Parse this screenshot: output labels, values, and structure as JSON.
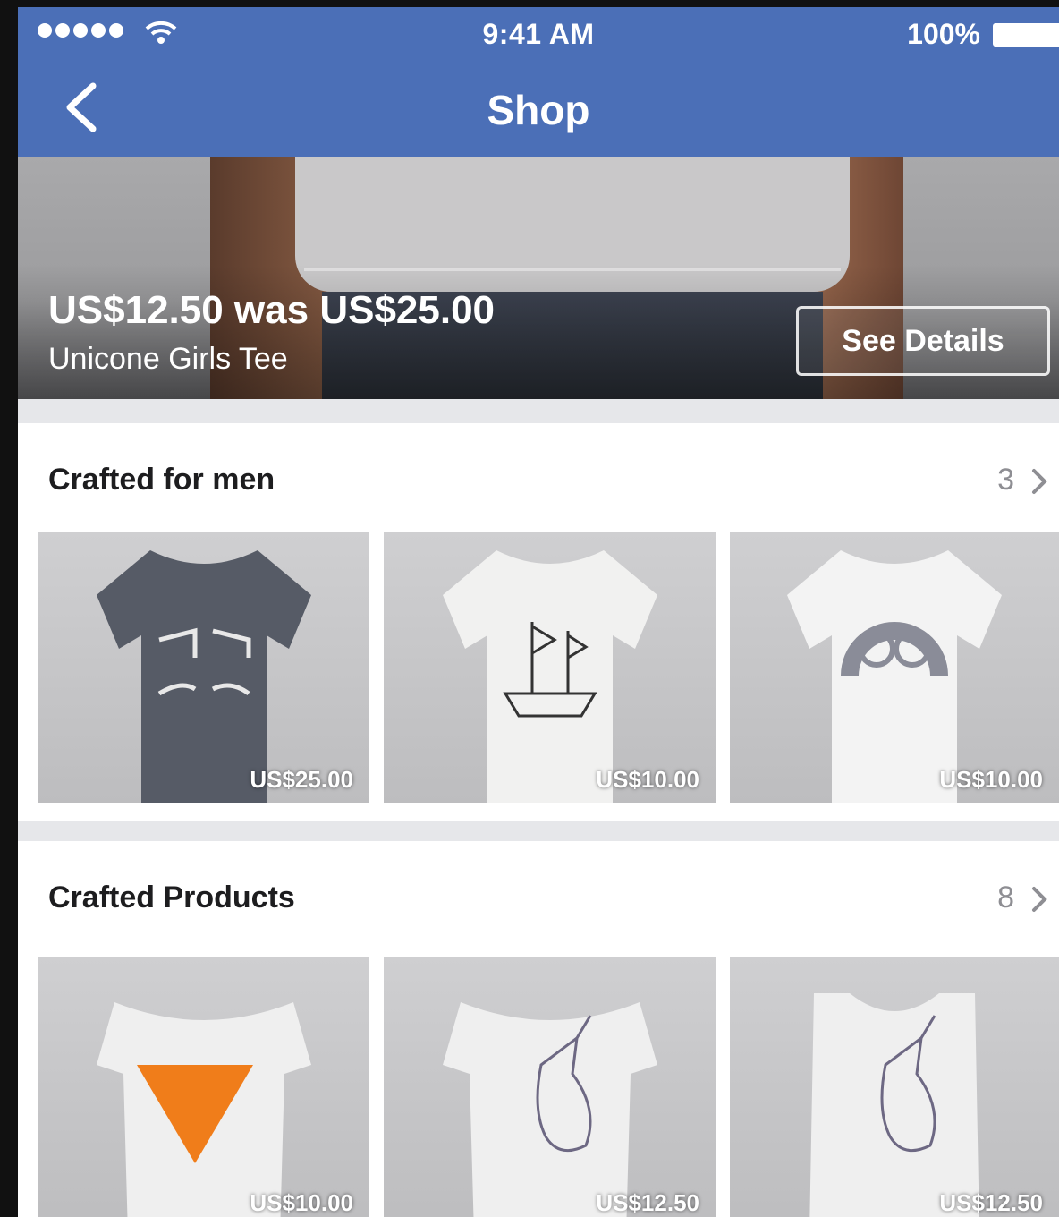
{
  "status_bar": {
    "time": "9:41 AM",
    "battery": "100%"
  },
  "nav": {
    "title": "Shop",
    "back_icon": "chevron-left-icon"
  },
  "hero": {
    "price_line": "US$12.50 was US$25.00",
    "product_name": "Unicone Girls Tee",
    "button_label": "See Details"
  },
  "sections": [
    {
      "title": "Crafted for men",
      "count": "3",
      "items": [
        {
          "price": "US$25.00",
          "shirt_color": "#565b66",
          "print": "gate-icon"
        },
        {
          "price": "US$10.00",
          "shirt_color": "#f1f1f0",
          "print": "ship-icon"
        },
        {
          "price": "US$10.00",
          "shirt_color": "#f3f3f3",
          "print": "owl-icon"
        }
      ]
    },
    {
      "title": "Crafted Products",
      "count": "8",
      "items": [
        {
          "price": "US$10.00",
          "shirt_color": "#efefef",
          "print": "triangle-icon"
        },
        {
          "price": "US$12.50",
          "shirt_color": "#efefef",
          "print": "unicorn-icon"
        },
        {
          "price": "US$12.50",
          "shirt_color": "#efefef",
          "print": "unicorn-icon"
        }
      ]
    }
  ],
  "colors": {
    "nav_blue": "#4b6fb7",
    "background": "#e6e7ea",
    "accent_orange": "#f07d1a"
  }
}
